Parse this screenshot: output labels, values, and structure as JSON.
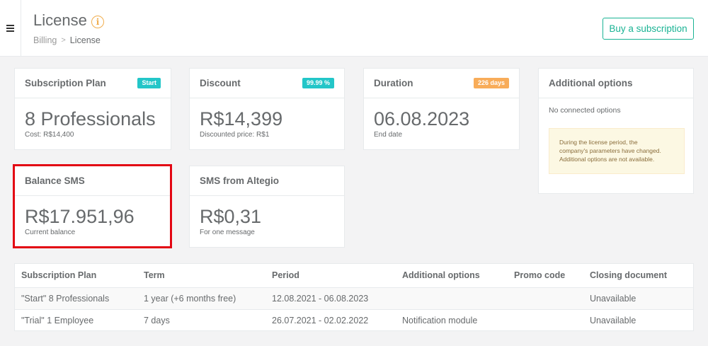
{
  "header": {
    "title": "License",
    "breadcrumb": {
      "parent": "Billing",
      "current": "License"
    },
    "buy_button": "Buy a subscription"
  },
  "icons": {
    "menu": "hamburger-menu-icon",
    "info": "info-icon",
    "breadcrumb_separator": "chevron-right-icon"
  },
  "colors": {
    "accent": "#1ab394",
    "badge_teal": "#23c6c8",
    "badge_orange": "#f8ac59",
    "highlight": "#e30613",
    "info": "#f0ad4e"
  },
  "cards": {
    "subscription_plan": {
      "title": "Subscription Plan",
      "badge": "Start",
      "value": "8 Professionals",
      "sub": "Cost: R$14,400"
    },
    "discount": {
      "title": "Discount",
      "badge": "99.99 %",
      "value": "R$14,399",
      "sub": "Discounted price: R$1"
    },
    "duration": {
      "title": "Duration",
      "badge": "226 days",
      "value": "06.08.2023",
      "sub": "End date"
    },
    "additional_options": {
      "title": "Additional options",
      "no_options": "No connected options",
      "warning_line1": "During the license period, the",
      "warning_line2": "company's parameters have changed.",
      "warning_line3": "Additional options are not available."
    },
    "balance_sms": {
      "title": "Balance SMS",
      "value": "R$17.951,96",
      "sub": "Current balance"
    },
    "sms_from": {
      "title": "SMS from Altegio",
      "value": "R$0,31",
      "sub": "For one message"
    }
  },
  "table": {
    "columns": [
      "Subscription Plan",
      "Term",
      "Period",
      "Additional options",
      "Promo code",
      "Closing document"
    ],
    "rows": [
      [
        "\"Start\" 8 Professionals",
        "1 year (+6 months free)",
        "12.08.2021 - 06.08.2023",
        "",
        "",
        "Unavailable"
      ],
      [
        "\"Trial\" 1 Employee",
        "7 days",
        "26.07.2021 - 02.02.2022",
        "Notification module",
        "",
        "Unavailable"
      ]
    ]
  }
}
